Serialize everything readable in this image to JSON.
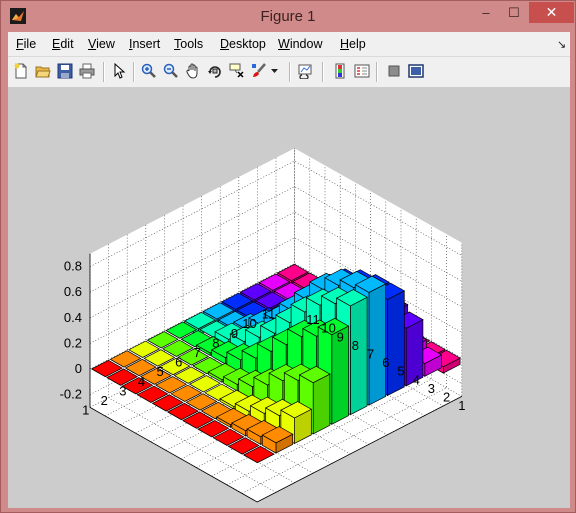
{
  "window": {
    "title": "Figure 1",
    "minimize": "–",
    "maximize": "☐",
    "close": "✕"
  },
  "menu": [
    {
      "label": "File",
      "key": "F"
    },
    {
      "label": "Edit",
      "key": "E"
    },
    {
      "label": "View",
      "key": "V"
    },
    {
      "label": "Insert",
      "key": "I"
    },
    {
      "label": "Tools",
      "key": "T"
    },
    {
      "label": "Desktop",
      "key": "D"
    },
    {
      "label": "Window",
      "key": "W"
    },
    {
      "label": "Help",
      "key": "H"
    }
  ],
  "toolbar": [
    {
      "name": "new-figure-icon"
    },
    {
      "name": "open-file-icon"
    },
    {
      "name": "save-icon"
    },
    {
      "name": "print-icon"
    },
    {
      "name": "edit-plot-arrow-icon"
    },
    {
      "name": "zoom-in-icon"
    },
    {
      "name": "zoom-out-icon"
    },
    {
      "name": "pan-hand-icon"
    },
    {
      "name": "rotate-3d-icon"
    },
    {
      "name": "data-cursor-icon"
    },
    {
      "name": "brush-icon"
    },
    {
      "name": "brush-dropdown-icon"
    },
    {
      "name": "link-plot-icon"
    },
    {
      "name": "insert-colorbar-icon"
    },
    {
      "name": "insert-legend-icon"
    },
    {
      "name": "hide-plot-tools-icon"
    },
    {
      "name": "show-plot-tools-icon"
    }
  ],
  "chart_data": {
    "type": "bar3",
    "z_tick_labels": [
      "-0.2",
      "0",
      "0.2",
      "0.4",
      "0.6",
      "0.8"
    ],
    "x_tick_labels": [
      "1",
      "2",
      "3",
      "4",
      "5",
      "6",
      "7",
      "8",
      "9",
      "10",
      "11"
    ],
    "y_tick_labels": [
      "11",
      "10",
      "9",
      "8",
      "7",
      "6",
      "5",
      "4",
      "3",
      "2",
      "1"
    ],
    "zlim": [
      -0.3,
      0.9
    ],
    "grid": true,
    "colormap": "hsv",
    "note_columns": "11 rows of 11 bars; each row colored by hsv colormap, approximate heights",
    "rows": [
      [
        0,
        0,
        0,
        0,
        0,
        0,
        0,
        0,
        0,
        0,
        0
      ],
      [
        0,
        0,
        0,
        0,
        0,
        0,
        0,
        0.02,
        0.04,
        0.06,
        0.08
      ],
      [
        0,
        0,
        0,
        0,
        0,
        0,
        0.02,
        0.05,
        0.1,
        0.15,
        0.2
      ],
      [
        0,
        0,
        0,
        0,
        0.02,
        0.05,
        0.1,
        0.18,
        0.28,
        0.35,
        0.4
      ],
      [
        0,
        0,
        0.02,
        0.05,
        0.1,
        0.18,
        0.3,
        0.42,
        0.55,
        0.62,
        0.7
      ],
      [
        -0.05,
        0,
        0.05,
        0.1,
        0.2,
        0.3,
        0.45,
        0.6,
        0.72,
        0.8,
        0.85
      ],
      [
        -0.08,
        -0.02,
        0.05,
        0.15,
        0.25,
        0.4,
        0.55,
        0.7,
        0.8,
        0.85,
        0.88
      ],
      [
        -0.1,
        -0.05,
        0.02,
        0.12,
        0.25,
        0.4,
        0.55,
        0.66,
        0.72,
        0.75,
        0.75
      ],
      [
        -0.12,
        -0.08,
        0,
        0.08,
        0.2,
        0.32,
        0.42,
        0.5,
        0.52,
        0.5,
        0.45
      ],
      [
        -0.15,
        -0.1,
        -0.05,
        0.02,
        0.08,
        0.15,
        0.2,
        0.22,
        0.2,
        0.15,
        0.1
      ],
      [
        -0.2,
        -0.15,
        -0.1,
        -0.05,
        0,
        0.02,
        0.03,
        0.02,
        0,
        -0.02,
        -0.05
      ]
    ]
  }
}
